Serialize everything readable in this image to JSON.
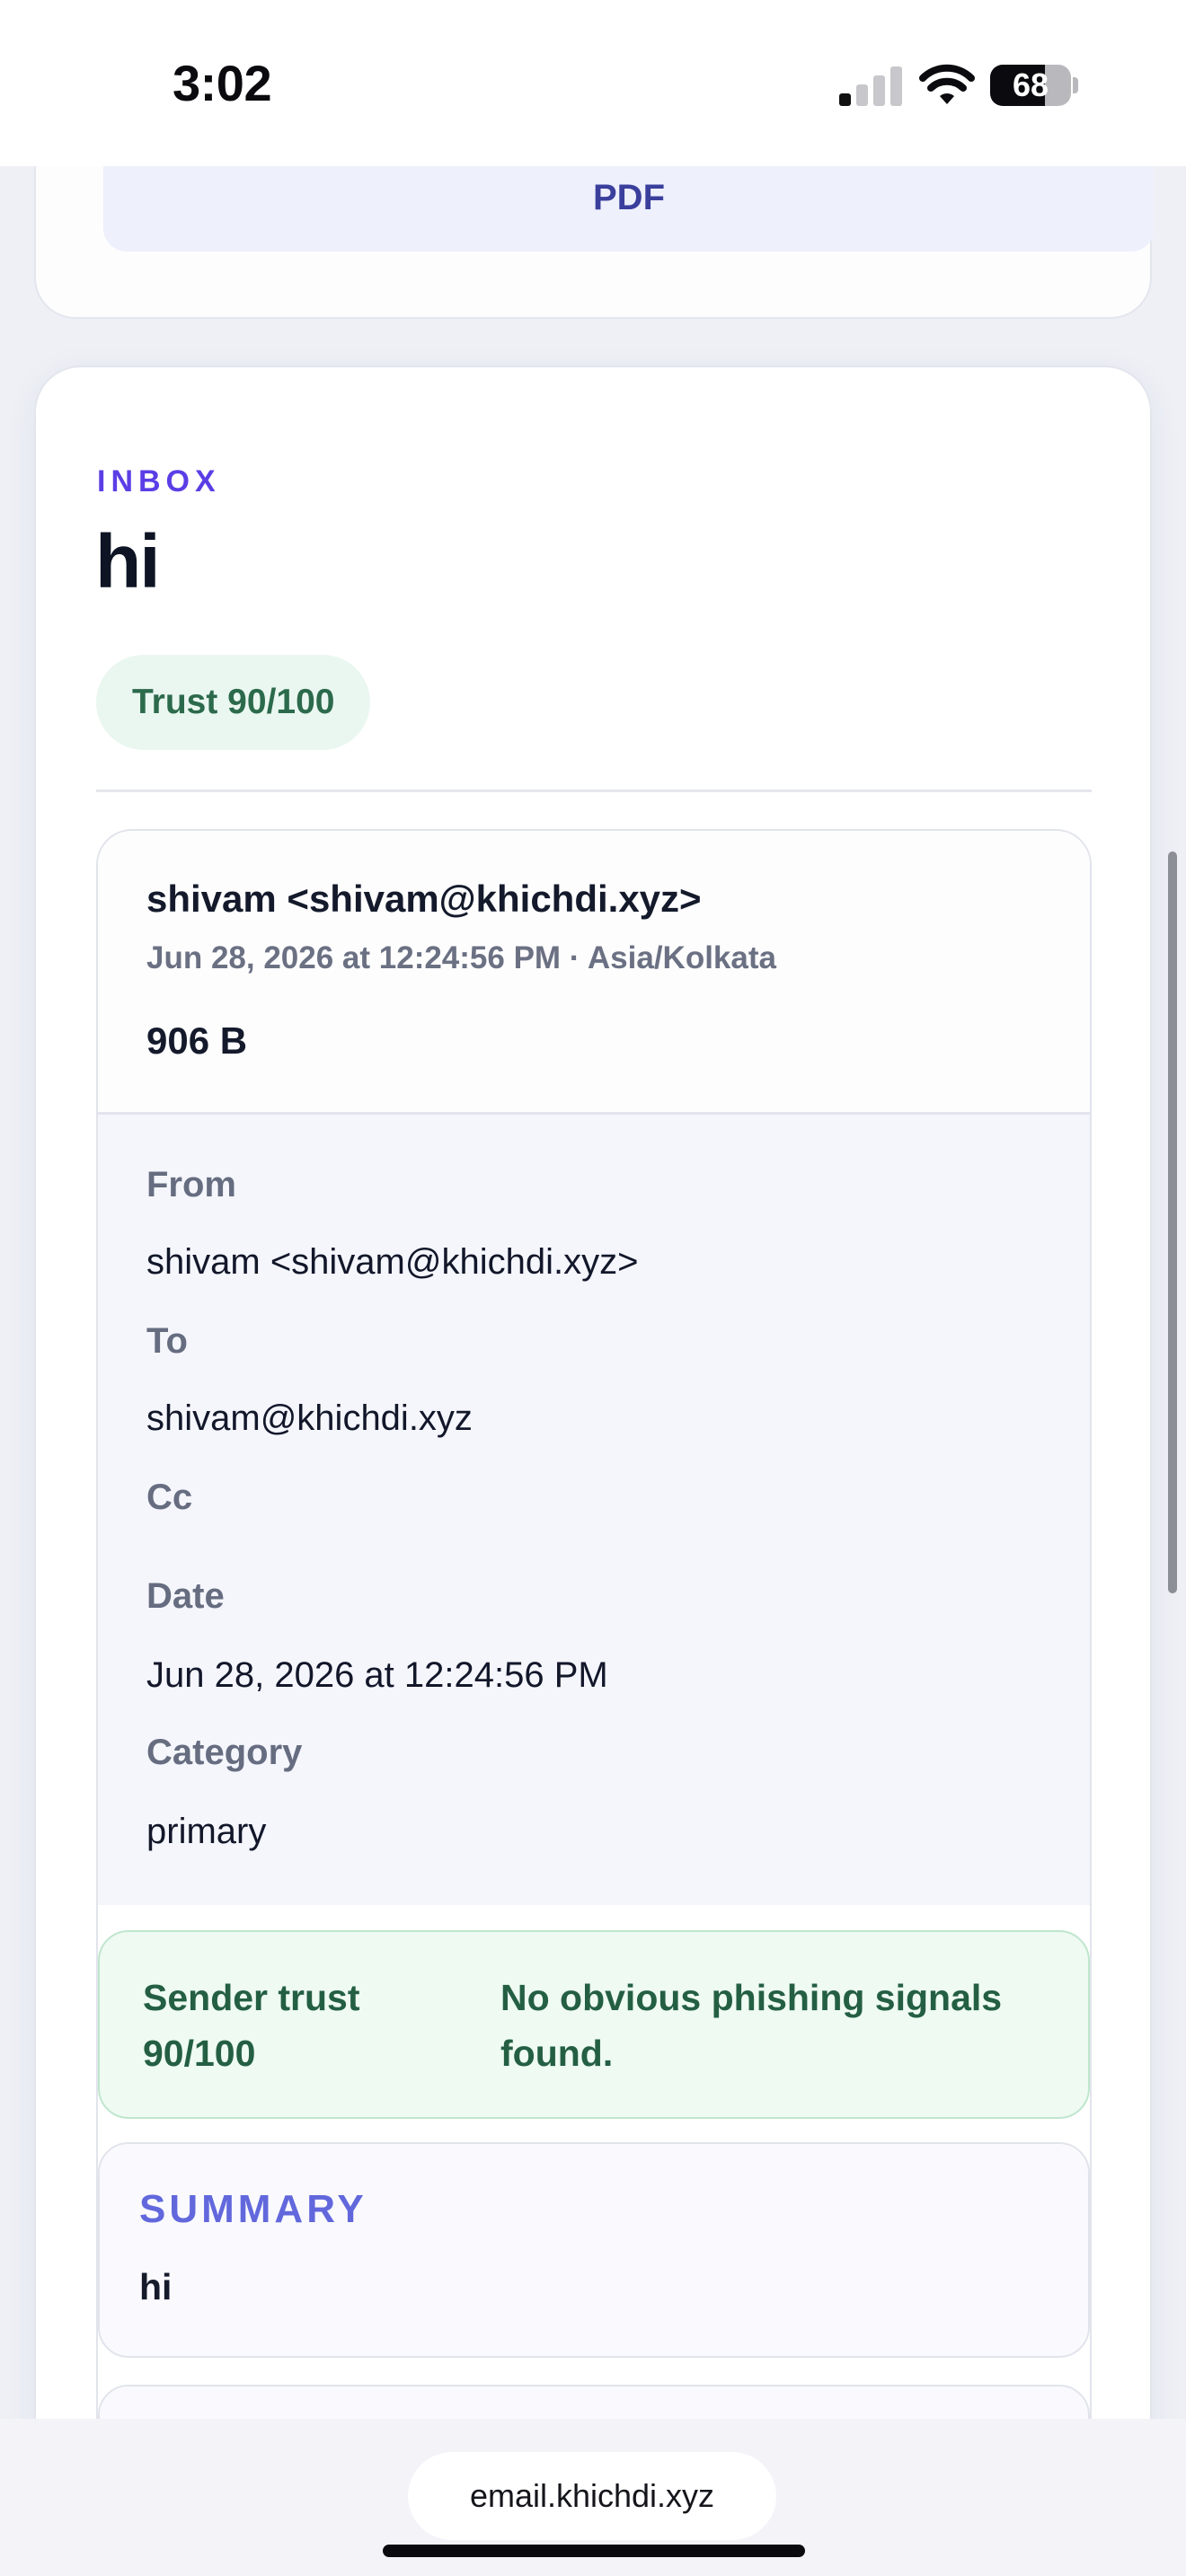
{
  "status_bar": {
    "time": "3:02",
    "battery_percent": "68",
    "signal_bars_active": 1,
    "signal_bars_total": 4,
    "icons": [
      "cellular-signal-icon",
      "wifi-icon",
      "battery-icon"
    ]
  },
  "actions": {
    "pdf_label": "PDF"
  },
  "email": {
    "mailbox": "INBOX",
    "subject": "hi",
    "trust_badge": "Trust 90/100",
    "sender": "shivam <shivam@khichdi.xyz>",
    "date_line": "Jun 28, 2026 at 12:24:56 PM · Asia/Kolkata",
    "size": "906 B",
    "fields": {
      "from_label": "From",
      "from_value": "shivam <shivam@khichdi.xyz>",
      "to_label": "To",
      "to_value": "shivam@khichdi.xyz",
      "cc_label": "Cc",
      "cc_value": "",
      "date_label": "Date",
      "date_value": "Jun 28, 2026 at 12:24:56 PM",
      "category_label": "Category",
      "category_value": "primary"
    },
    "trust_panel": {
      "label": "Sender trust 90/100",
      "message": "No obvious phishing signals found."
    },
    "summary": {
      "title": "SUMMARY",
      "text": "hi"
    }
  },
  "browser": {
    "url": "email.khichdi.xyz"
  },
  "colors": {
    "accent": "#5b3ee6",
    "trust_green": "#2c6a4c",
    "summary_accent": "#6268dc",
    "pdf_text": "#3a3f9c"
  }
}
